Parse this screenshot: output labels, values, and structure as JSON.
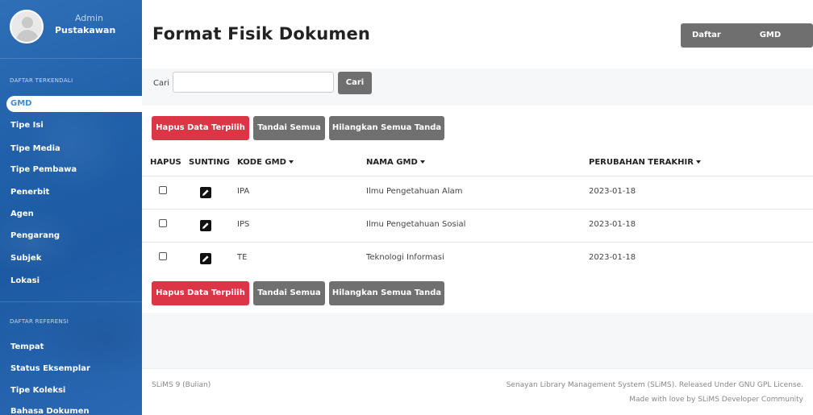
{
  "user": {
    "role": "Admin",
    "name": "Pustakawan"
  },
  "sidebar": {
    "section1": "DAFTAR TERKENDALI",
    "items1": [
      {
        "label": "GMD",
        "active": true
      },
      {
        "label": "Tipe Isi"
      },
      {
        "label": "Tipe Media"
      },
      {
        "label": "Tipe Pembawa"
      },
      {
        "label": "Penerbit"
      },
      {
        "label": "Agen"
      },
      {
        "label": "Pengarang"
      },
      {
        "label": "Subjek"
      },
      {
        "label": "Lokasi"
      }
    ],
    "section2": "DAFTAR REFERENSI",
    "items2": [
      {
        "label": "Tempat"
      },
      {
        "label": "Status Eksemplar"
      },
      {
        "label": "Tipe Koleksi"
      },
      {
        "label": "Bahasa Dokumen"
      }
    ]
  },
  "header": {
    "title": "Format Fisik Dokumen",
    "buttons": [
      "Daftar GMD",
      "GMD Baru"
    ]
  },
  "search": {
    "label": "Cari",
    "placeholder": "",
    "button": "Cari"
  },
  "actions": {
    "delete_selected": "Hapus Data Terpilih",
    "check_all": "Tandai Semua",
    "uncheck_all": "Hilangkan Semua Tanda"
  },
  "table": {
    "headers": [
      "HAPUS",
      "SUNTING",
      "KODE GMD",
      "NAMA GMD",
      "PERUBAHAN TERAKHIR"
    ],
    "rows": [
      {
        "code": "IPA",
        "name": "Ilmu Pengetahuan Alam",
        "updated": "2023-01-18"
      },
      {
        "code": "IPS",
        "name": "Ilmu Pengetahuan Sosial",
        "updated": "2023-01-18"
      },
      {
        "code": "TE",
        "name": "Teknologi Informasi",
        "updated": "2023-01-18"
      }
    ]
  },
  "footer": {
    "version": "SLiMS 9 (Bulian)",
    "license": "Senayan Library Management System (SLiMS). Released Under GNU GPL License.",
    "credit": "Made with love by SLiMS Developer Community"
  },
  "colors": {
    "sidebar": "#2060aa",
    "accent": "#3a8fd6",
    "danger": "#dc3545",
    "button_gray": "#707070"
  }
}
